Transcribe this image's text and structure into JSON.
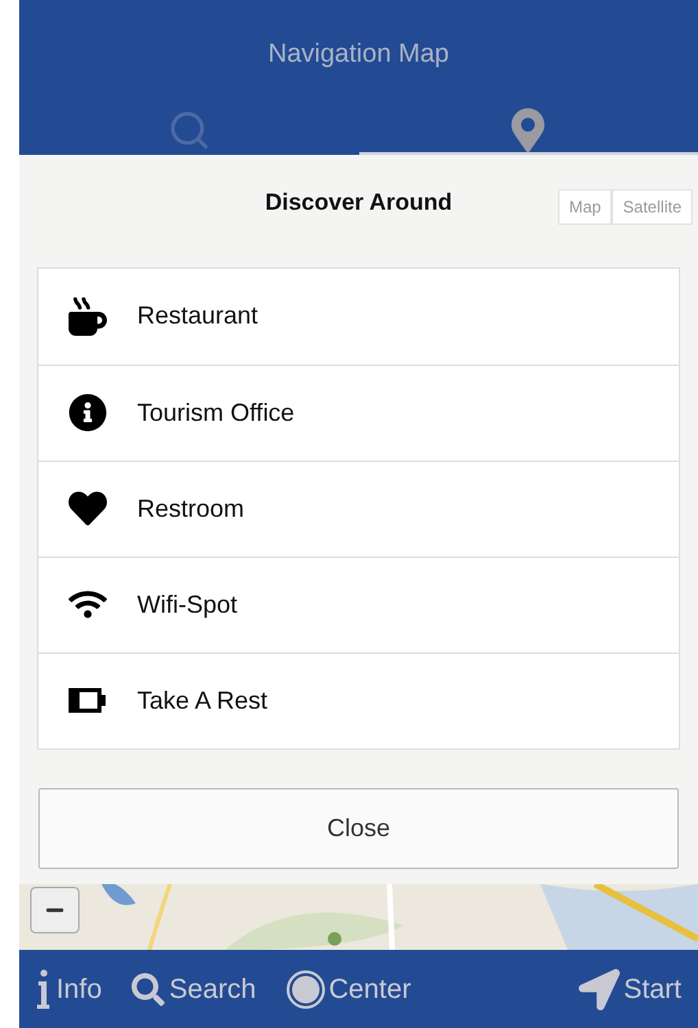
{
  "header": {
    "title": "Navigation Map",
    "tabs": [
      {
        "selected": false
      },
      {
        "selected": true
      }
    ]
  },
  "map_type": [
    "Map",
    "Satellite"
  ],
  "dialog": {
    "title": "Discover Around",
    "items": [
      "Restaurant",
      "Tourism Office",
      "Restroom",
      "Wifi-Spot",
      "Take A Rest"
    ],
    "close": "Close"
  },
  "bottom_bar": [
    "Info",
    "Search",
    "Center",
    "Start"
  ]
}
